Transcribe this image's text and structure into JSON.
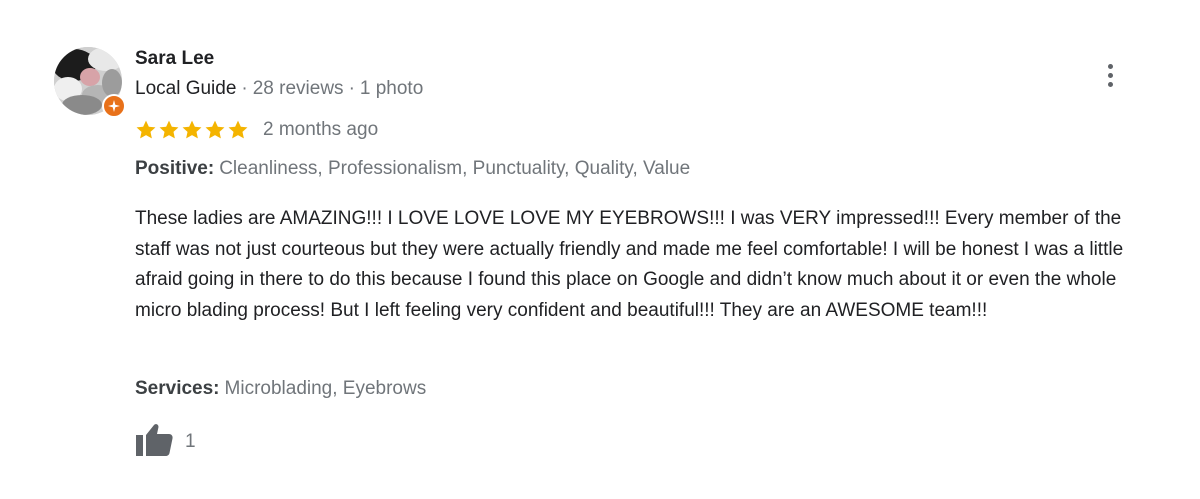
{
  "review": {
    "author": "Sara Lee",
    "author_type": "Local Guide",
    "review_count": "28 reviews",
    "photo_count": "1 photo",
    "separator": "·",
    "rating": 5,
    "rating_max": 5,
    "time": "2 months ago",
    "positive_label": "Positive:",
    "positive_values": "Cleanliness, Professionalism, Punctuality, Quality, Value",
    "text": "These ladies are AMAZING!!! I LOVE LOVE LOVE MY EYEBROWS!!! I was VERY impressed!!! Every member of the staff was not just courteous but they were actually friendly and made me feel comfortable! I will be honest I was a little afraid going in there to do this because I found this place on Google and didn’t know much about it or even the whole micro blading process! But I left feeling very confident and beautiful!!! They are an AWESOME team!!!",
    "services_label": "Services:",
    "services_values": "Microblading, Eyebrows",
    "likes": "1"
  },
  "icons": {
    "more": "more-vert-icon",
    "star": "star-icon",
    "like": "thumbs-up-icon",
    "badge": "local-guide-badge-icon"
  },
  "colors": {
    "star": "#f4b400",
    "guide_badge": "#e8711a",
    "secondary_text": "#70757a",
    "primary_text": "#202124",
    "icon_gray": "#5f6368"
  }
}
